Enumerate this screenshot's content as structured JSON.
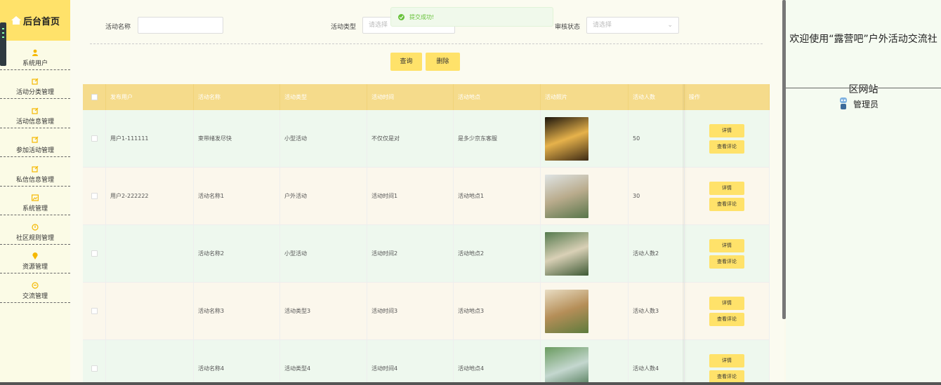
{
  "sidebar": {
    "brand": "后台首页",
    "items": [
      {
        "label": "系统用户",
        "icon": "user-icon"
      },
      {
        "label": "活动分类管理",
        "icon": "edit-icon"
      },
      {
        "label": "活动信息管理",
        "icon": "edit-icon"
      },
      {
        "label": "参加活动管理",
        "icon": "edit-icon"
      },
      {
        "label": "私信信息管理",
        "icon": "edit-icon"
      },
      {
        "label": "系统管理",
        "icon": "image-icon"
      },
      {
        "label": "社区规则管理",
        "icon": "info-icon"
      },
      {
        "label": "资源管理",
        "icon": "pin-icon"
      },
      {
        "label": "交流管理",
        "icon": "chat-icon"
      }
    ]
  },
  "toast": {
    "text": "提交成功!"
  },
  "search": {
    "name_label": "活动名称",
    "name_value": "",
    "type_label": "活动类型",
    "type_placeholder": "请选择",
    "status_label": "审核状态",
    "status_placeholder": "请选择",
    "query_btn": "查询",
    "delete_btn": "删除"
  },
  "table": {
    "headers": [
      "发布用户",
      "活动名称",
      "活动类型",
      "活动时间",
      "活动地点",
      "活动照片",
      "活动人数",
      "操作"
    ],
    "rows": [
      {
        "user": "用户1-111111",
        "name": "束带绪发尽快",
        "type": "小型活动",
        "time": "不仅仅是对",
        "place": "是多少京东客服",
        "count": "50",
        "photo_colors": [
          "#1b140c",
          "#e6b24b",
          "#3d2a14"
        ]
      },
      {
        "user": "用户2-222222",
        "name": "活动名称1",
        "type": "户外活动",
        "time": "活动时间1",
        "place": "活动地点1",
        "count": "30",
        "photo_colors": [
          "#dfe4e4",
          "#b9ab8c",
          "#58754a"
        ]
      },
      {
        "user": "",
        "name": "活动名称2",
        "type": "小型活动",
        "time": "活动时间2",
        "place": "活动地点2",
        "count": "活动人数2",
        "photo_colors": [
          "#557a4e",
          "#d9d0b6",
          "#3e5a35"
        ]
      },
      {
        "user": "",
        "name": "活动名称3",
        "type": "活动类型3",
        "time": "活动时间3",
        "place": "活动地点3",
        "count": "活动人数3",
        "photo_colors": [
          "#e9ddc3",
          "#b58e58",
          "#5e7b3c"
        ]
      },
      {
        "user": "",
        "name": "活动名称4",
        "type": "活动类型4",
        "time": "活动时间4",
        "place": "活动地点4",
        "count": "活动人数4",
        "photo_colors": [
          "#6a9b5f",
          "#c4d7cf",
          "#3f6c45"
        ]
      }
    ],
    "detail_btn": "详情",
    "comment_btn": "查看评论"
  },
  "right": {
    "welcome": "欢迎使用“露营吧”户外活动交流社区网站",
    "admin": "管理员"
  },
  "colors": {
    "accent": "#ffe26a",
    "header": "#f5db8b",
    "success": "#67c23a"
  }
}
